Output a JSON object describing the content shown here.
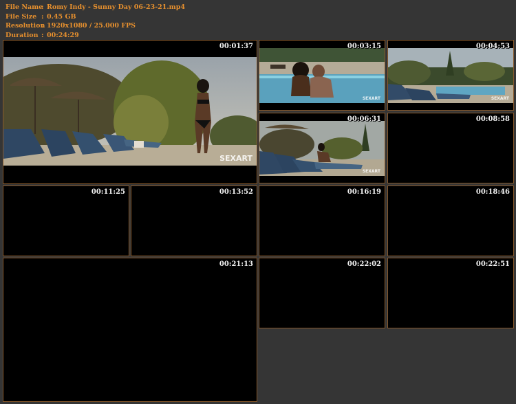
{
  "info": {
    "file_name_label": "File Name",
    "file_name_sep": ":",
    "file_name": "Romy Indy - Sunny Day 06-23-21.mp4",
    "file_size_label": "File Size",
    "file_size_sep": ":",
    "file_size": "0.45 GB",
    "resolution_label": "Resolution",
    "resolution_sep": ":",
    "resolution": "1920x1080 / 25.000 FPS",
    "duration_label": "Duration",
    "duration_sep": ":",
    "duration": "00:24:29"
  },
  "thumbnails": [
    {
      "time": "00:01:37",
      "watermark": "SEXART"
    },
    {
      "time": "00:03:15",
      "watermark": "SEXART"
    },
    {
      "time": "00:04:53",
      "watermark": "SEXART"
    },
    {
      "time": "00:06:31",
      "watermark": "SEXART"
    },
    {
      "time": "00:08:58"
    },
    {
      "time": "00:11:25"
    },
    {
      "time": "00:13:52"
    },
    {
      "time": "00:16:19"
    },
    {
      "time": "00:18:46"
    },
    {
      "time": "00:21:13"
    },
    {
      "time": "00:22:02"
    },
    {
      "time": "00:22:51"
    }
  ],
  "colors": {
    "background": "#353535",
    "info_text": "#e7902e",
    "tile_border": "#8a5a2c",
    "tile_fill": "#000000",
    "timestamp_text": "#f1f1f1"
  }
}
